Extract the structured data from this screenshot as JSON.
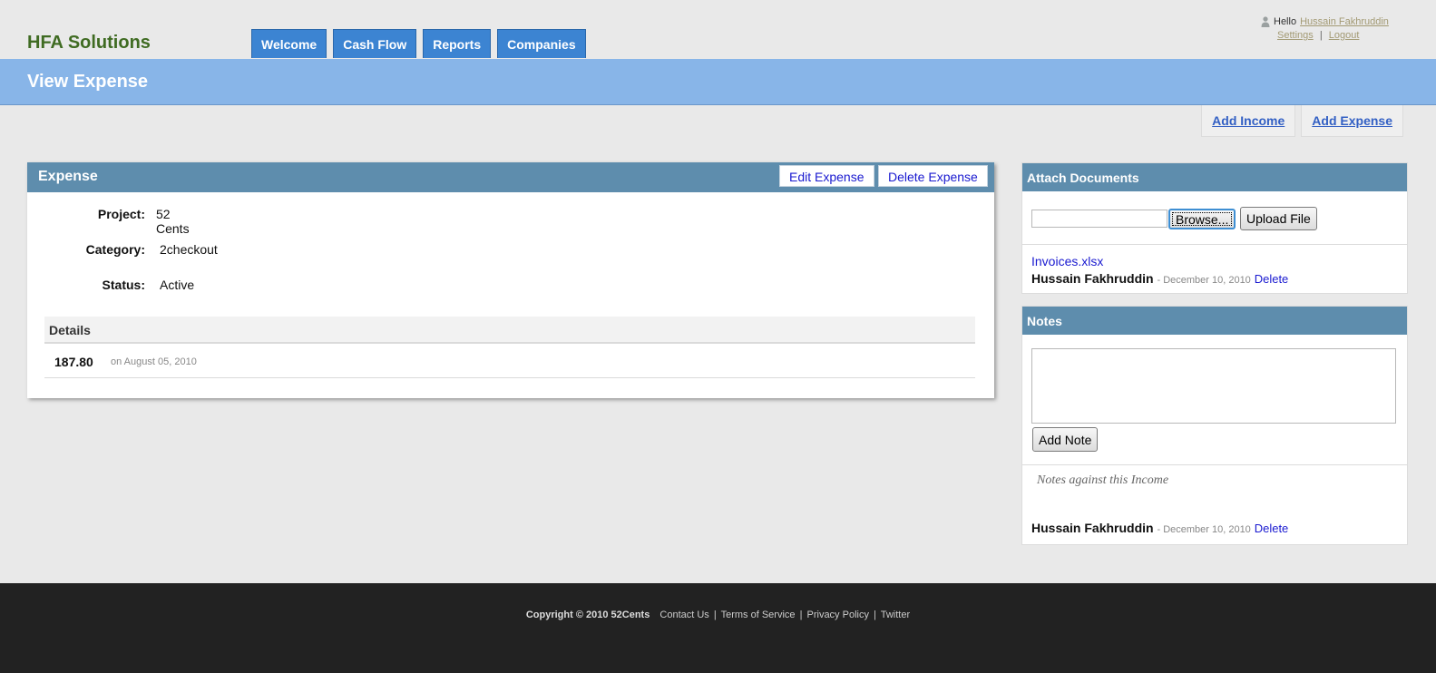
{
  "header": {
    "brand": "HFA Solutions",
    "tabs": [
      {
        "label": "Welcome"
      },
      {
        "label": "Cash Flow"
      },
      {
        "label": "Reports"
      },
      {
        "label": "Companies"
      }
    ],
    "user": {
      "greeting": "Hello",
      "name": "Hussain Fakhruddin",
      "settings": "Settings",
      "separator": "|",
      "logout": "Logout"
    }
  },
  "page": {
    "title": "View Expense",
    "quick_links": {
      "add_income": "Add Income",
      "add_expense": "Add Expense"
    }
  },
  "expense": {
    "heading": "Expense",
    "edit_label": "Edit Expense",
    "delete_label": "Delete Expense",
    "fields": {
      "project": {
        "label": "Project:",
        "value": "52 Cents"
      },
      "category": {
        "label": "Category:",
        "value": "2checkout"
      },
      "status": {
        "label": "Status:",
        "value": "Active"
      }
    },
    "details": {
      "heading": "Details",
      "amount": "187.80",
      "date_text": "on August 05, 2010"
    }
  },
  "attach": {
    "heading": "Attach Documents",
    "browse_label": "Browse...",
    "upload_label": "Upload File",
    "file_name": "Invoices.xlsx",
    "uploaded_by": "Hussain Fakhruddin",
    "uploaded_date": "- December 10, 2010",
    "delete_label": "Delete"
  },
  "notes": {
    "heading": "Notes",
    "add_label": "Add Note",
    "caption": "Notes against this Income",
    "author": "Hussain Fakhruddin",
    "date": "- December 10, 2010",
    "delete_label": "Delete"
  },
  "footer": {
    "copyright": "Copyright © 2010 52Cents",
    "links": [
      "Contact Us",
      "Terms of Service",
      "Privacy Policy",
      "Twitter"
    ],
    "separator": "|"
  },
  "colors": {
    "tab_bg": "#3c84d2",
    "title_band": "#88b5e8",
    "panel_head": "#5e8dad",
    "brand_green": "#3f6b22",
    "link_blue": "#1a1ad0",
    "footer_bg": "#222222"
  }
}
